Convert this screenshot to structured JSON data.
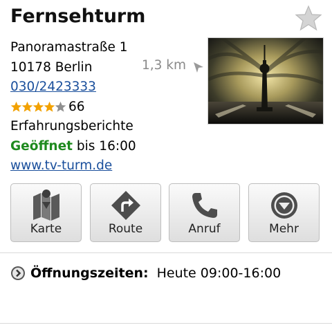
{
  "place": {
    "name": "Fernsehturm",
    "address_line1": "Panoramastraße 1",
    "address_line2": "10178 Berlin",
    "phone": "030/2423333",
    "rating_stars": 4,
    "rating_max": 5,
    "review_count": "66",
    "reviews_label": "Erfahrungsberichte",
    "status": "Geöffnet",
    "status_until": "bis 16:00",
    "website": "www.tv-turm.de",
    "distance": "1,3 km"
  },
  "actions": [
    {
      "label": "Karte",
      "icon": "map-icon"
    },
    {
      "label": "Route",
      "icon": "route-icon"
    },
    {
      "label": "Anruf",
      "icon": "phone-icon"
    },
    {
      "label": "Mehr",
      "icon": "more-icon"
    }
  ],
  "hours": {
    "label": "Öffnungszeiten:",
    "value": "Heute 09:00-16:00"
  },
  "colors": {
    "link": "#1a4f9c",
    "open": "#1e8a1e",
    "star": "#f2a100"
  }
}
